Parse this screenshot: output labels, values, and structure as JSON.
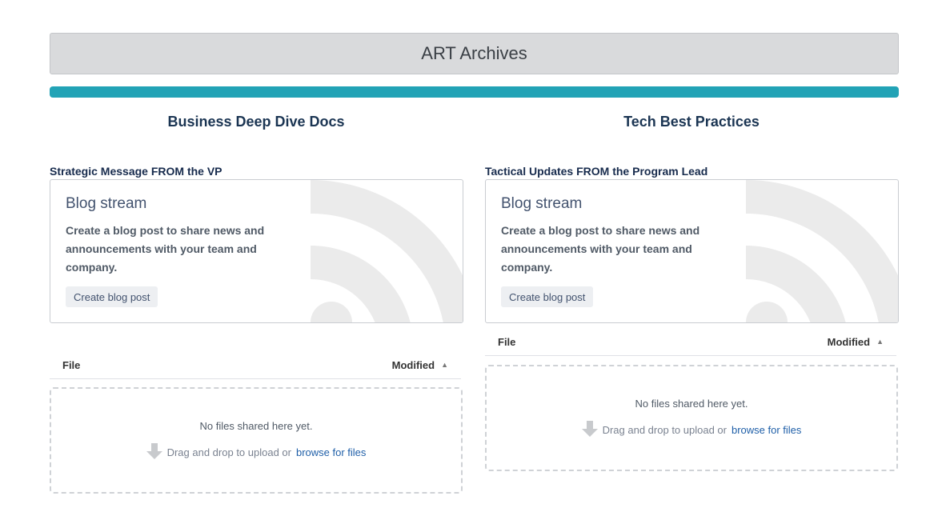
{
  "banner": {
    "title": "ART Archives"
  },
  "colors": {
    "accent_bar": "#22a3b6",
    "link": "#1f5fa8",
    "title": "#1b3553"
  },
  "left_column": {
    "title": "Business Deep Dive Docs",
    "section_label": "Strategic Message FROM the VP",
    "blog": {
      "heading": "Blog stream",
      "description": "Create a blog post to share news and announcements with your team and company.",
      "button_label": "Create blog post",
      "icon": "rss-feed-icon"
    },
    "files": {
      "col_file": "File",
      "col_modified": "Modified",
      "sort_icon": "sort-ascending-icon",
      "empty_text": "No files shared here yet.",
      "drag_text": "Drag and drop to upload or",
      "browse_label": "browse for files",
      "upload_icon": "download-arrow-icon"
    }
  },
  "right_column": {
    "title": "Tech Best Practices",
    "section_label": "Tactical Updates FROM the Program Lead",
    "blog": {
      "heading": "Blog stream",
      "description": "Create a blog post to share news and announcements with your team and company.",
      "button_label": "Create blog post",
      "icon": "rss-feed-icon"
    },
    "files": {
      "col_file": "File",
      "col_modified": "Modified",
      "sort_icon": "sort-ascending-icon",
      "empty_text": "No files shared here yet.",
      "drag_text": "Drag and drop to upload or",
      "browse_label": "browse for files",
      "upload_icon": "download-arrow-icon"
    }
  }
}
